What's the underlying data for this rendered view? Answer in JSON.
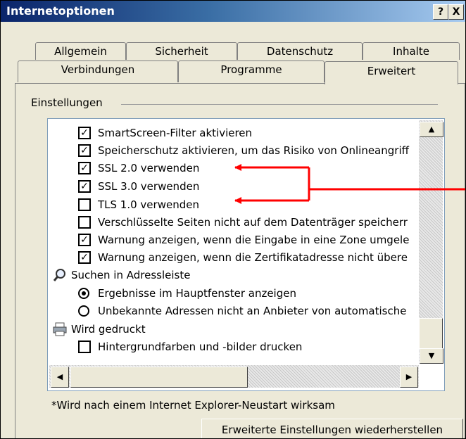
{
  "window": {
    "title": "Internetoptionen",
    "help_button": "?",
    "close_button": "X"
  },
  "tabs": {
    "row1": [
      "Allgemein",
      "Sicherheit",
      "Datenschutz",
      "Inhalte"
    ],
    "row2": [
      "Verbindungen",
      "Programme",
      "Erweitert"
    ],
    "active": "Erweitert"
  },
  "settings": {
    "section_label": "Einstellungen",
    "items": [
      {
        "kind": "checkbox",
        "checked": true,
        "label": "SmartScreen-Filter aktivieren"
      },
      {
        "kind": "checkbox",
        "checked": true,
        "label": "Speicherschutz aktivieren, um das Risiko von Onlineangriff"
      },
      {
        "kind": "checkbox",
        "checked": true,
        "label": "SSL 2.0 verwenden"
      },
      {
        "kind": "checkbox",
        "checked": true,
        "label": "SSL 3.0 verwenden"
      },
      {
        "kind": "checkbox",
        "checked": false,
        "label": "TLS 1.0 verwenden"
      },
      {
        "kind": "checkbox",
        "checked": false,
        "label": "Verschlüsselte Seiten nicht auf dem Datenträger speicherr"
      },
      {
        "kind": "checkbox",
        "checked": true,
        "label": "Warnung anzeigen, wenn die Eingabe in eine Zone umgele"
      },
      {
        "kind": "checkbox",
        "checked": true,
        "label": "Warnung anzeigen, wenn die Zertifikatadresse nicht übere"
      },
      {
        "kind": "group",
        "icon": "magnifier-icon",
        "label": "Suchen in Adressleiste"
      },
      {
        "kind": "radio",
        "checked": true,
        "label": "Ergebnisse im Hauptfenster anzeigen"
      },
      {
        "kind": "radio",
        "checked": false,
        "label": "Unbekannte Adressen nicht an Anbieter von automatische"
      },
      {
        "kind": "group",
        "icon": "printer-icon",
        "label": "Wird gedruckt"
      },
      {
        "kind": "checkbox",
        "checked": false,
        "label": "Hintergrundfarben und -bilder drucken"
      }
    ]
  },
  "scroll": {
    "up": "▲",
    "down": "▼",
    "left": "◀",
    "right": "▶"
  },
  "footer": {
    "note": "*Wird nach einem Internet Explorer-Neustart wirksam",
    "restore_button": "Erweiterte Einstellungen wiederherstellen"
  },
  "colors": {
    "annotation_arrow": "#ff0000",
    "titlebar_start": "#0a246a",
    "titlebar_end": "#a6caf0",
    "dialog_background": "#ece9d8"
  }
}
